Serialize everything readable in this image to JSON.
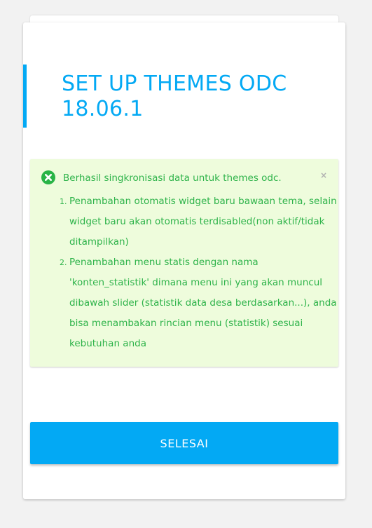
{
  "page": {
    "title": "SET UP THEMES ODC 18.06.1"
  },
  "alert": {
    "icon": "close-circle-icon",
    "message": "Berhasil singkronisasi data untuk themes odc.",
    "close_label": "×",
    "items": [
      "Penambahan otomatis widget baru bawaan tema, selain widget baru akan otomatis terdisabled(non aktif/tidak ditampilkan)",
      "Penambahan menu statis dengan nama 'konten_statistik' dimana menu ini yang akan muncul dibawah slider (statistik data desa berdasarkan...), anda bisa menambakan rincian menu (statistik) sesuai kebutuhan anda"
    ]
  },
  "actions": {
    "finish_label": "SELESAI"
  },
  "colors": {
    "accent": "#03a9f4",
    "success_text": "#2eb34a",
    "success_bg": "#eefcdc"
  }
}
